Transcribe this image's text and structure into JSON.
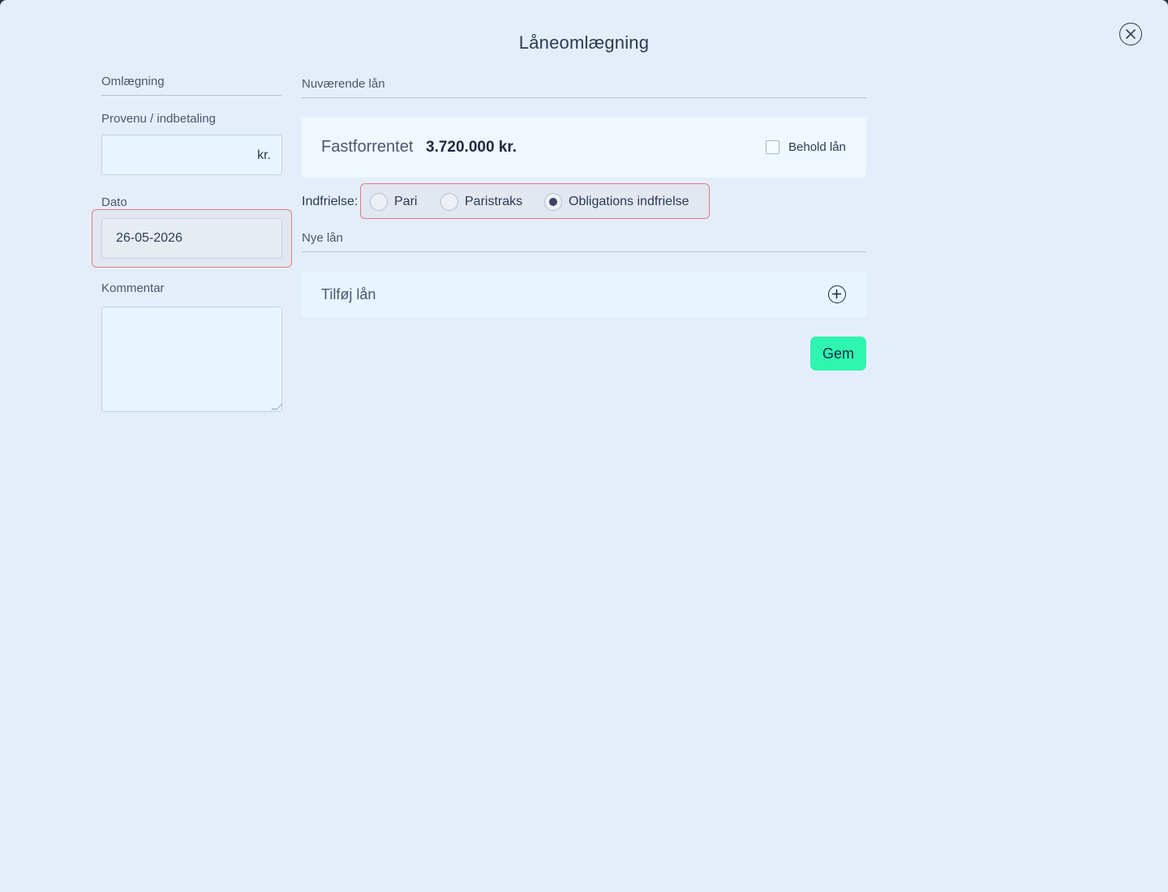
{
  "modal": {
    "title": "Låneomlægning",
    "close_icon": "close-circle-icon"
  },
  "left": {
    "section_title": "Omlægning",
    "proceeds_label": "Provenu / indbetaling",
    "proceeds_value": "",
    "proceeds_suffix": "kr.",
    "date_label": "Dato",
    "date_value": "26-05-2026",
    "comment_label": "Kommentar",
    "comment_value": ""
  },
  "current_loans": {
    "section_title": "Nuværende lån",
    "loan": {
      "type": "Fastforrentet",
      "amount": "3.720.000 kr.",
      "keep_label": "Behold lån",
      "keep_checked": false
    },
    "redemption": {
      "label": "Indfrielse:",
      "options": [
        "Pari",
        "Paristraks",
        "Obligations indfrielse"
      ],
      "selected": "Obligations indfrielse"
    }
  },
  "new_loans": {
    "section_title": "Nye lån",
    "add_label": "Tilføj lån",
    "add_icon": "plus-circle-icon"
  },
  "actions": {
    "save_label": "Gem"
  },
  "colors": {
    "background": "#e4eefa",
    "card": "#eef8ff",
    "accent_button": "#2ef5b0",
    "error_outline": "#e37b85",
    "text": "#2b3a55"
  }
}
